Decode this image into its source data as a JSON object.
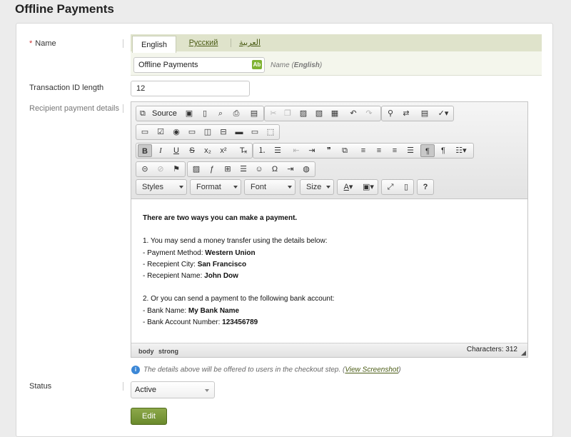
{
  "page_title": "Offline Payments",
  "form": {
    "name_label": "Name",
    "required_mark": "*",
    "languages": [
      {
        "label": "English",
        "active": true
      },
      {
        "label": "Русский",
        "active": false
      },
      {
        "label": "العربية",
        "active": false
      }
    ],
    "name_value": "Offline Payments",
    "name_hint_prefix": "Name (",
    "name_hint_lang": "English",
    "name_hint_suffix": ")",
    "ab_icon_text": "Ab",
    "transaction_label": "Transaction ID length",
    "transaction_value": "12",
    "recipient_label": "Recipient payment details",
    "status_label": "Status",
    "status_value": "Active",
    "edit_label": "Edit"
  },
  "editor": {
    "source_label": "Source",
    "combos": {
      "styles": "Styles",
      "format": "Format",
      "font": "Font",
      "size": "Size"
    },
    "content": {
      "intro": "There are two ways you can make a payment.",
      "option1": "1. You may send a money transfer using the details below:",
      "method_label": "- Payment Method: ",
      "method_value": "Western Union",
      "city_label": "- Recepient City: ",
      "city_value": "San Francisco",
      "recipient_label": "- Recepient Name: ",
      "recipient_value": "John Dow",
      "option2": "2. Or you can send a payment to the following bank account:",
      "bank_label": "- Bank Name: ",
      "bank_value": "My Bank Name",
      "account_label": "- Bank Account Number: ",
      "account_value": "123456789"
    },
    "path": [
      "body",
      "strong"
    ],
    "char_count": "Characters: 312"
  },
  "info": {
    "text": "The details above will be offered to users in the checkout step. (",
    "link": "View Screenshot",
    "suffix": ")"
  },
  "colors": {
    "accent_green": "#6a8a2c",
    "link_green": "#4a5b14",
    "info_blue": "#3b87d6"
  }
}
